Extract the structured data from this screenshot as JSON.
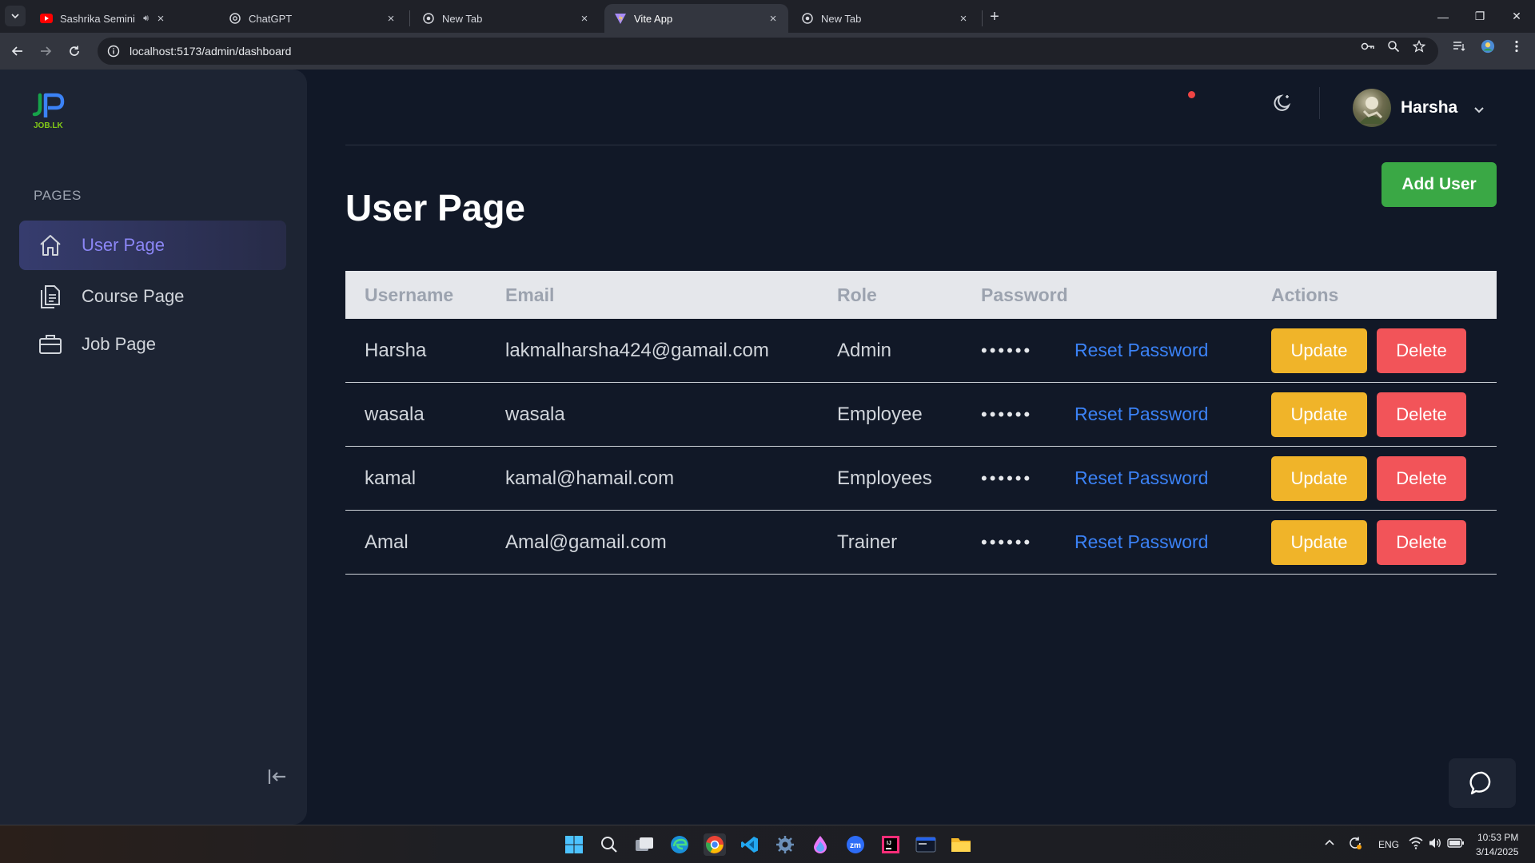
{
  "browser": {
    "tabs": [
      {
        "title": "Sashrika Semini | Solo Roun",
        "favicon": "youtube-icon",
        "active": false
      },
      {
        "title": "ChatGPT",
        "favicon": "chatgpt-icon",
        "active": false
      },
      {
        "title": "New Tab",
        "favicon": "chrome-icon",
        "active": false
      },
      {
        "title": "Vite App",
        "favicon": "vite-icon",
        "active": true
      },
      {
        "title": "New Tab",
        "favicon": "chrome-icon",
        "active": false
      }
    ],
    "url": "localhost:5173/admin/dashboard"
  },
  "sidebar": {
    "logo_text": "JOB.LK",
    "section_label": "PAGES",
    "items": [
      {
        "label": "User Page",
        "icon": "home-icon",
        "active": true
      },
      {
        "label": "Course Page",
        "icon": "document-icon",
        "active": false
      },
      {
        "label": "Job Page",
        "icon": "briefcase-icon",
        "active": false
      }
    ]
  },
  "header": {
    "user_name": "Harsha"
  },
  "main": {
    "title": "User Page",
    "add_user_label": "Add User"
  },
  "table": {
    "columns": [
      "Username",
      "Email",
      "Role",
      "Password",
      "Actions"
    ],
    "rows": [
      {
        "username": "Harsha",
        "email": "lakmalharsha424@gamail.com",
        "role": "Admin",
        "password": "••••••",
        "reset": "Reset Password",
        "update": "Update",
        "delete": "Delete"
      },
      {
        "username": "wasala",
        "email": "wasala",
        "role": "Employee",
        "password": "••••••",
        "reset": "Reset Password",
        "update": "Update",
        "delete": "Delete"
      },
      {
        "username": "kamal",
        "email": "kamal@hamail.com",
        "role": "Employees",
        "password": "••••••",
        "reset": "Reset Password",
        "update": "Update",
        "delete": "Delete"
      },
      {
        "username": "Amal",
        "email": "Amal@gamail.com",
        "role": "Trainer",
        "password": "••••••",
        "reset": "Reset Password",
        "update": "Update",
        "delete": "Delete"
      }
    ]
  },
  "taskbar": {
    "language": "ENG",
    "time": "10:53 PM",
    "date": "3/14/2025"
  },
  "colors": {
    "accent": "#8b86f5",
    "add_button": "#3aa845",
    "update_button": "#f0b429",
    "delete_button": "#f25459",
    "link": "#3b82f6"
  }
}
